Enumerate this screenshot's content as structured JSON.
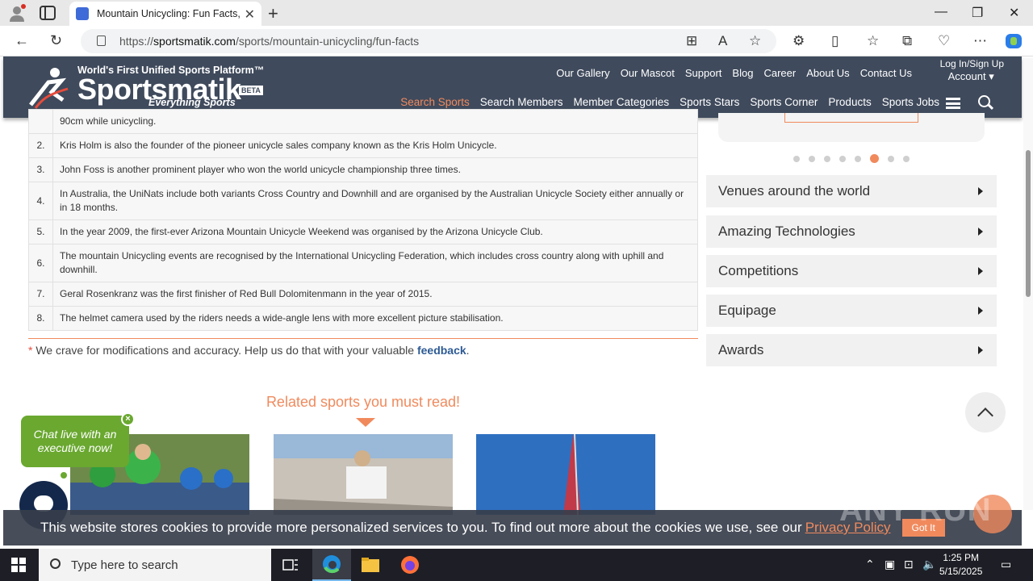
{
  "browser": {
    "tab_title": "Mountain Unicycling: Fun Facts, ...",
    "url_prefix": "https://",
    "url_domain": "sportsmatik.com",
    "url_path": "/sports/mountain-unicycling/fun-facts"
  },
  "site": {
    "tagline": "World's First Unified Sports Platform™",
    "name": "Sportsmatik",
    "beta": "BETA",
    "subtitle": "Everything Sports",
    "top_nav": [
      "Our Gallery",
      "Our Mascot",
      "Support",
      "Blog",
      "Career",
      "About Us",
      "Contact Us"
    ],
    "login": "Log In/Sign Up",
    "account": "Account ▾",
    "main_nav": [
      "Search Sports",
      "Search Members",
      "Member Categories",
      "Sports Stars",
      "Sports Corner",
      "Products",
      "Sports Jobs"
    ]
  },
  "facts": {
    "rows": [
      {
        "num": "",
        "text": "90cm while unicycling."
      },
      {
        "num": "2.",
        "text": "Kris Holm is also the founder of the pioneer unicycle sales company known as the Kris Holm Unicycle."
      },
      {
        "num": "3.",
        "text": "John Foss is another prominent player who won the world unicycle championship three times."
      },
      {
        "num": "4.",
        "text": "In Australia, the UniNats include both variants Cross Country and Downhill and are organised by the Australian Unicycle Society either annually or in 18 months."
      },
      {
        "num": "5.",
        "text": "In the year 2009, the first-ever Arizona Mountain Unicycle Weekend was organised by the Arizona Unicycle Club."
      },
      {
        "num": "6.",
        "text": "The mountain Unicycling events are recognised by the International Unicycling Federation, which includes cross country along with uphill and downhill."
      },
      {
        "num": "7.",
        "text": "Geral Rosenkranz was the first finisher of Red Bull Dolomitenmann in the year of 2015."
      },
      {
        "num": "8.",
        "text": "The helmet camera used by the riders needs a wide-angle lens with more excellent picture stabilisation."
      }
    ],
    "crave_star": "*",
    "crave_text": " We crave for modifications and accuracy. Help us do that with your valuable ",
    "crave_link": "feedback",
    "crave_end": "."
  },
  "related": {
    "title": "Related sports you must read!"
  },
  "sidebar": {
    "dots_count": 8,
    "active_dot": 6,
    "items": [
      "Venues around the world",
      "Amazing Technologies",
      "Competitions",
      "Equipage",
      "Awards"
    ]
  },
  "chat": {
    "text": "Chat live with an executive now!",
    "close": "×"
  },
  "cookie": {
    "text": "This website stores cookies to provide more personalized services to you. To find out more about the cookies we use, see our",
    "link": "Privacy Policy",
    "button": "Got It"
  },
  "watermark": "ANY RUN",
  "taskbar": {
    "search_placeholder": "Type here to search",
    "time": "1:25 PM",
    "date": "5/15/2025"
  }
}
